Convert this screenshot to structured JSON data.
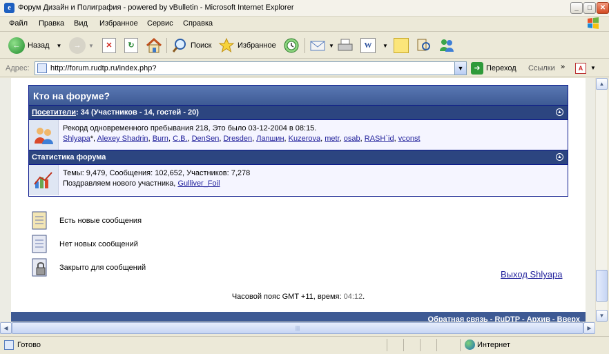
{
  "window": {
    "title": "Форум Дизайн и Полиграфия - powered by vBulletin - Microsoft Internet Explorer",
    "app_icon": "e"
  },
  "menu": [
    "Файл",
    "Правка",
    "Вид",
    "Избранное",
    "Сервис",
    "Справка"
  ],
  "toolbar": {
    "back_label": "Назад",
    "search_label": "Поиск",
    "favorites_label": "Избранное"
  },
  "address": {
    "label": "Адрес:",
    "url": "http://forum.rudtp.ru/index.php?",
    "go_label": "Переход",
    "links_label": "Ссылки"
  },
  "forum": {
    "whos_online_title": "Кто на форуме?",
    "visitors_link": "Посетители",
    "visitors_summary": ": 34 (Участников - 14, гостей - 20)",
    "record_text": "Рекорд одновременного пребывания 218, Это было 03-12-2004 в 08:15.",
    "online_users": [
      "Shlyapa",
      "Alexey Shadrin",
      "Burn",
      "C.B.",
      "DenSen",
      "Dresden",
      "Лапшин",
      "Kuzerova",
      "metr",
      "osab",
      "RASH`id",
      "vconst"
    ],
    "first_user_marker": "*",
    "stats_title": "Статистика форума",
    "stats_line": "Темы: 9,479, Сообщения: 102,652, Участников: 7,278",
    "welcome_prefix": "Поздравляем нового участника, ",
    "newest_member": "Gulliver_Foil"
  },
  "legend": {
    "new_posts": "Есть новые сообщения",
    "no_new_posts": "Нет новых сообщений",
    "closed": "Закрыто для сообщений"
  },
  "logout": "Выход Shlyapa",
  "timezone": {
    "prefix": "Часовой пояс GMT +11, время: ",
    "time": "04:12",
    "suffix": "."
  },
  "footer_links": "Обратная связь - RuDTP - Архив - Вверх",
  "status": {
    "text": "Готово",
    "zone": "Интернет"
  },
  "colors": {
    "header_blue": "#3e5a94",
    "border_navy": "#0b198c",
    "link": "#22229c"
  }
}
